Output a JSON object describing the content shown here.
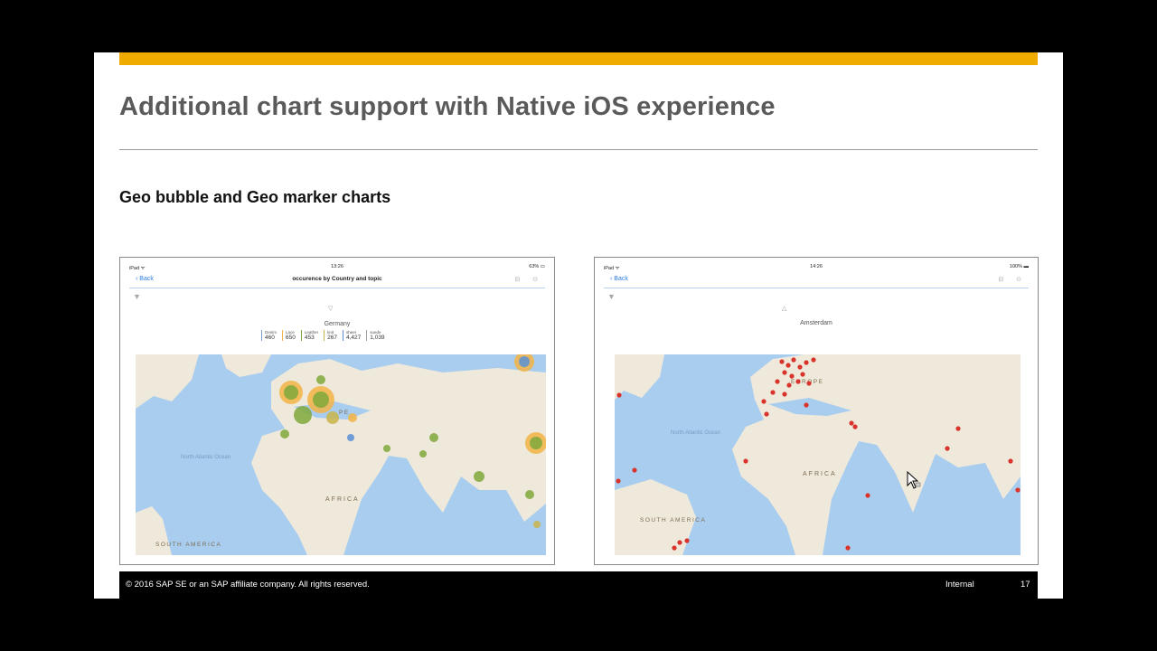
{
  "slide": {
    "title": "Additional chart support with Native iOS experience",
    "subtitle": "Geo bubble and Geo marker charts",
    "accent_color": "#f0ab00",
    "footer": {
      "copyright": "© 2016 SAP SE or an SAP affiliate company. All rights reserved.",
      "classification": "Internal",
      "page_number": "17"
    }
  },
  "left_screen": {
    "status": {
      "carrier": "iPad ᯤ",
      "time": "13:26",
      "battery": "63% ▭"
    },
    "nav": {
      "back": "‹ Back",
      "title": "occurence by Country and topic",
      "icons": "⊟ ⊙"
    },
    "region": "Germany",
    "legend": [
      {
        "name": "Denim",
        "value": "460"
      },
      {
        "name": "Lace",
        "value": "650"
      },
      {
        "name": "Leather",
        "value": "453"
      },
      {
        "name": "knit",
        "value": "267"
      },
      {
        "name": "sheer",
        "value": "4,427"
      },
      {
        "name": "suede",
        "value": "1,039"
      }
    ],
    "map_labels": {
      "north_atlantic": "North Atlantic Ocean",
      "africa": "AFRICA",
      "south_america": "SOUTH AMERICA",
      "europe": "PE"
    }
  },
  "right_screen": {
    "status": {
      "carrier": "iPad ᯤ",
      "time": "14:26",
      "battery": "100% ▬"
    },
    "nav": {
      "back": "‹ Back",
      "title": "",
      "icons": "⊟ ⊙"
    },
    "region": "Amsterdam",
    "map_labels": {
      "north_atlantic": "North Atlantic Ocean",
      "africa": "AFRICA",
      "south_america": "SOUTH AMERICA",
      "europe": "EUROPE"
    }
  },
  "colors": {
    "ocean": "#a8cdee",
    "land": "#efe9dc",
    "bubble_green": "#7fa83a",
    "bubble_orange": "#f2b447",
    "marker_red": "#d9342b"
  }
}
